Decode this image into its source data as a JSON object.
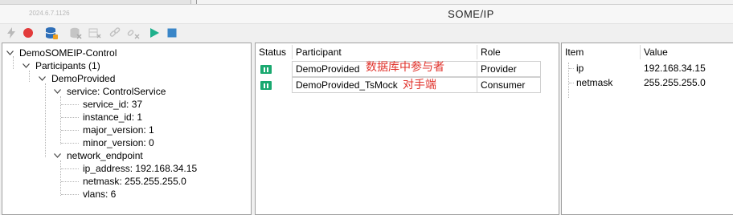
{
  "app": {
    "version": "2024.6.7.1126",
    "title": "SOME/IP"
  },
  "toolbar": {
    "buttons": [
      {
        "icon": "lightning-icon",
        "enabled": false
      },
      {
        "icon": "record-icon",
        "enabled": true,
        "color": "#e23b3b"
      },
      {
        "icon": "database-icon",
        "enabled": true,
        "color": "#2f6fb8"
      },
      {
        "icon": "database-remove-icon",
        "enabled": false
      },
      {
        "icon": "columns-icon",
        "enabled": false
      },
      {
        "icon": "link-icon",
        "enabled": false
      },
      {
        "icon": "unlink-icon",
        "enabled": false
      },
      {
        "icon": "play-icon",
        "enabled": true,
        "color": "#1fb08c"
      },
      {
        "icon": "stop-icon",
        "enabled": true,
        "color": "#3a86c8"
      }
    ]
  },
  "tree": {
    "root": "DemoSOMEIP-Control",
    "participants_label": "Participants (1)",
    "participant": "DemoProvided",
    "service_label": "service: ControlService",
    "service_fields": [
      "service_id: 37",
      "instance_id: 1",
      "major_version: 1",
      "minor_version: 0"
    ],
    "endpoint_label": "network_endpoint",
    "endpoint_fields": [
      "ip_address: 192.168.34.15",
      "netmask: 255.255.255.0",
      "vlans: 6"
    ]
  },
  "participants_table": {
    "headers": [
      "Status",
      "Participant",
      "Role"
    ],
    "rows": [
      {
        "participant": "DemoProvided",
        "role": "Provider",
        "annotation": "数据库中参与者"
      },
      {
        "participant": "DemoProvided_TsMock",
        "role": "Consumer",
        "annotation": "对手端"
      }
    ],
    "status_color": "#1aa970",
    "annotation_color": "#e0322b"
  },
  "properties_table": {
    "headers": [
      "Item",
      "Value"
    ],
    "rows": [
      {
        "item": "ip",
        "value": "192.168.34.15"
      },
      {
        "item": "netmask",
        "value": "255.255.255.0"
      }
    ]
  }
}
